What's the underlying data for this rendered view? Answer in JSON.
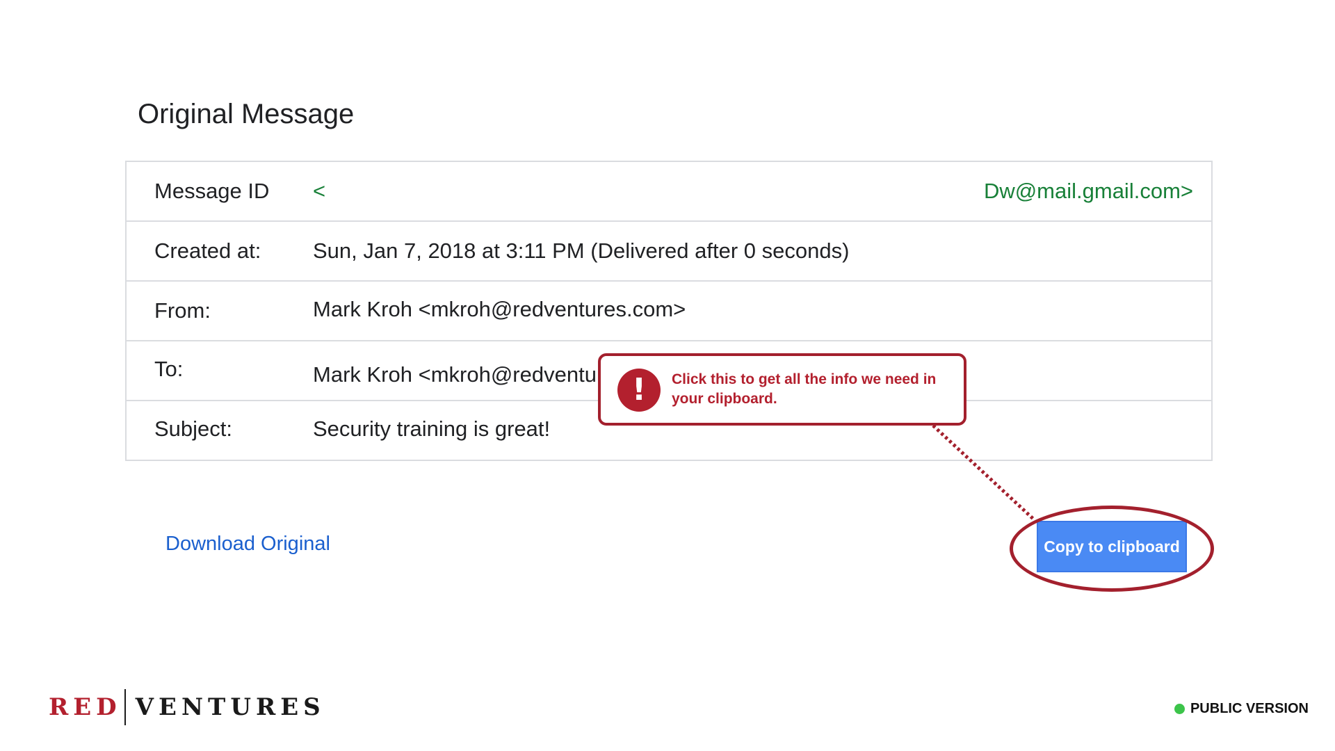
{
  "page": {
    "title": "Original Message"
  },
  "headers": {
    "rows": [
      {
        "label": "Message ID",
        "value": "<",
        "value_right": "Dw@mail.gmail.com>"
      },
      {
        "label": "Created at:",
        "value": "Sun, Jan 7, 2018 at 3:11 PM (Delivered after 0 seconds)"
      },
      {
        "label": "From:",
        "value": "Mark Kroh <mkroh@redventures.com>"
      },
      {
        "label": "To:",
        "value": "Mark Kroh <mkroh@redventu"
      },
      {
        "label": "Subject:",
        "value": "Security training is great!"
      }
    ]
  },
  "actions": {
    "download_label": "Download Original",
    "copy_label": "Copy to clipboard"
  },
  "callout": {
    "icon": "exclamation-icon",
    "icon_glyph": "!",
    "text": "Click this to get all the info we need in your clipboard."
  },
  "footer": {
    "logo_left": "RED",
    "logo_right": "VENTURES",
    "badge_label": "PUBLIC VERSION",
    "badge_color": "#3cc44a"
  },
  "colors": {
    "accent_red": "#a3202d",
    "link_blue": "#1a5fce",
    "button_blue": "#4a8af4",
    "green_text": "#188038"
  }
}
